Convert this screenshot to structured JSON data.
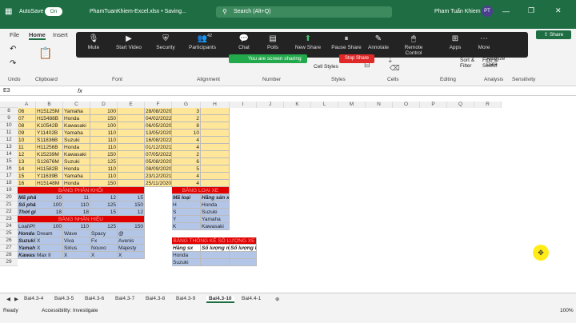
{
  "titlebar": {
    "autosave": "AutoSave",
    "toggle": "On",
    "filename": "PhamTuanKhiem-Excel.xlsx • Saving...",
    "search": "Search (Alt+Q)",
    "user": "Pham Tuấn Khiem",
    "initials": "PT"
  },
  "menu": [
    "File",
    "Home",
    "Insert"
  ],
  "share": "Share",
  "zoom": {
    "buttons": [
      {
        "label": "Mute",
        "icon": "mic-icon"
      },
      {
        "label": "Start Video",
        "icon": "video-icon"
      },
      {
        "label": "Security",
        "icon": "shield-icon"
      },
      {
        "label": "Participants",
        "icon": "people-icon",
        "count": "42"
      },
      {
        "label": "Chat",
        "icon": "chat-icon"
      },
      {
        "label": "Polls",
        "icon": "poll-icon"
      },
      {
        "label": "New Share",
        "icon": "share-icon"
      },
      {
        "label": "Pause Share",
        "icon": "pause-icon"
      },
      {
        "label": "Annotate",
        "icon": "pen-icon"
      },
      {
        "label": "Remote Control",
        "icon": "remote-icon"
      },
      {
        "label": "Apps",
        "icon": "apps-icon"
      },
      {
        "label": "More",
        "icon": "more-icon"
      }
    ],
    "sharing": "You are screen sharing",
    "stop": "Stop Share"
  },
  "ribbon": {
    "groups": [
      "Undo",
      "Clipboard",
      "Font",
      "Alignment",
      "Number",
      "Styles",
      "Cells",
      "Editing",
      "Analysis",
      "Sensitivity"
    ],
    "cellstyles": "Cell Styles",
    "sortfilter": "Sort & Filter",
    "findselect": "Find & Select",
    "analyze": "Analyze Data"
  },
  "namebox": "E3",
  "fx": "fx",
  "cols": [
    "A",
    "B",
    "C",
    "D",
    "E",
    "F",
    "G",
    "H",
    "I",
    "J",
    "K",
    "L",
    "M",
    "N",
    "O",
    "P",
    "Q",
    "R"
  ],
  "top_rows": [
    {
      "n": "8",
      "a": "06",
      "b": "H15125M",
      "c": "Yamaha",
      "d": "100",
      "f": "28/08/2020",
      "g": "3"
    },
    {
      "n": "9",
      "a": "07",
      "b": "H15488B",
      "c": "Honda",
      "d": "150",
      "f": "04/02/2022",
      "g": "2"
    },
    {
      "n": "10",
      "a": "08",
      "b": "K10542B",
      "c": "Kawasaki",
      "d": "100",
      "f": "06/05/2020",
      "g": "8"
    },
    {
      "n": "11",
      "a": "09",
      "b": "Y11402B",
      "c": "Yamaha",
      "d": "110",
      "f": "13/05/2020",
      "g": "10"
    },
    {
      "n": "12",
      "a": "10",
      "b": "S11836B",
      "c": "Suzuki",
      "d": "110",
      "f": "16/08/2022",
      "g": "4"
    },
    {
      "n": "13",
      "a": "11",
      "b": "H11256B",
      "c": "Honda",
      "d": "110",
      "f": "01/12/2021",
      "g": "4"
    },
    {
      "n": "14",
      "a": "12",
      "b": "K15239M",
      "c": "Kawasaki",
      "d": "150",
      "f": "07/05/2022",
      "g": "2"
    },
    {
      "n": "15",
      "a": "13",
      "b": "S12676M",
      "c": "Suzuki",
      "d": "125",
      "f": "05/08/2020",
      "g": "6"
    },
    {
      "n": "16",
      "a": "14",
      "b": "H11582B",
      "c": "Honda",
      "d": "110",
      "f": "08/09/2020",
      "g": "5"
    },
    {
      "n": "17",
      "a": "15",
      "b": "Y11639B",
      "c": "Yamaha",
      "d": "110",
      "f": "23/12/2021",
      "g": "4"
    },
    {
      "n": "18",
      "a": "16",
      "b": "H15148M",
      "c": "Honda",
      "d": "150",
      "f": "25/11/2020",
      "g": "4"
    }
  ],
  "lower_row_nums": [
    "19",
    "20",
    "21",
    "22",
    "23",
    "24",
    "25",
    "26",
    "27",
    "28",
    "29"
  ],
  "phankhoi": {
    "title": "BẢNG PHÂN KHỐI",
    "rows": [
      {
        "label": "Mã phân khối",
        "v": [
          "10",
          "11",
          "12",
          "15"
        ]
      },
      {
        "label": "Số phân khối",
        "v": [
          "100",
          "110",
          "125",
          "150"
        ]
      },
      {
        "label": "Thời gian bảo hành",
        "v": [
          "18",
          "18",
          "15",
          "12"
        ]
      }
    ]
  },
  "nhanhieu": {
    "title": "BẢNG NHÃN HIỆU",
    "header": [
      "Loại\\Phân Khối",
      "100",
      "110",
      "125",
      "150"
    ],
    "rows": [
      [
        "Honda",
        "Dream",
        "Wave",
        "Spacy",
        "@"
      ],
      [
        "Suzuki",
        "X",
        "Viva",
        "Fx",
        "Avenis"
      ],
      [
        "Yamaha",
        "X",
        "Sirius",
        "Nouvo",
        "Majesty"
      ],
      [
        "Kawasaki",
        "Max II",
        "X",
        "X",
        "X"
      ]
    ]
  },
  "loaixe": {
    "title": "BẢNG LOẠI XE",
    "header": [
      "Mã loại",
      "Hãng sản xuất"
    ],
    "rows": [
      [
        "H",
        "Honda"
      ],
      [
        "S",
        "Suzuki"
      ],
      [
        "Y",
        "Yamaha"
      ],
      [
        "K",
        "Kawasaki"
      ]
    ]
  },
  "thongke": {
    "title": "BẢNG THỐNG KÊ SỐ LƯỢNG XE",
    "header": [
      "Hãng sx",
      "Số lượng mua",
      "Số lượng bán"
    ],
    "rows": [
      "Honda",
      "Suzuki"
    ]
  },
  "tabs": [
    "Bai4.3-4",
    "Bai4.3-5",
    "Bai4.3-6",
    "Bai4.3-7",
    "Bai4.3-8",
    "Bai4.3-9",
    "Bai4.3-10",
    "Bai4.4-1"
  ],
  "active_tab": "Bai4.3-10",
  "status": {
    "ready": "Ready",
    "accessibility": "Accessibility: Investigate",
    "zoom": "100%"
  }
}
